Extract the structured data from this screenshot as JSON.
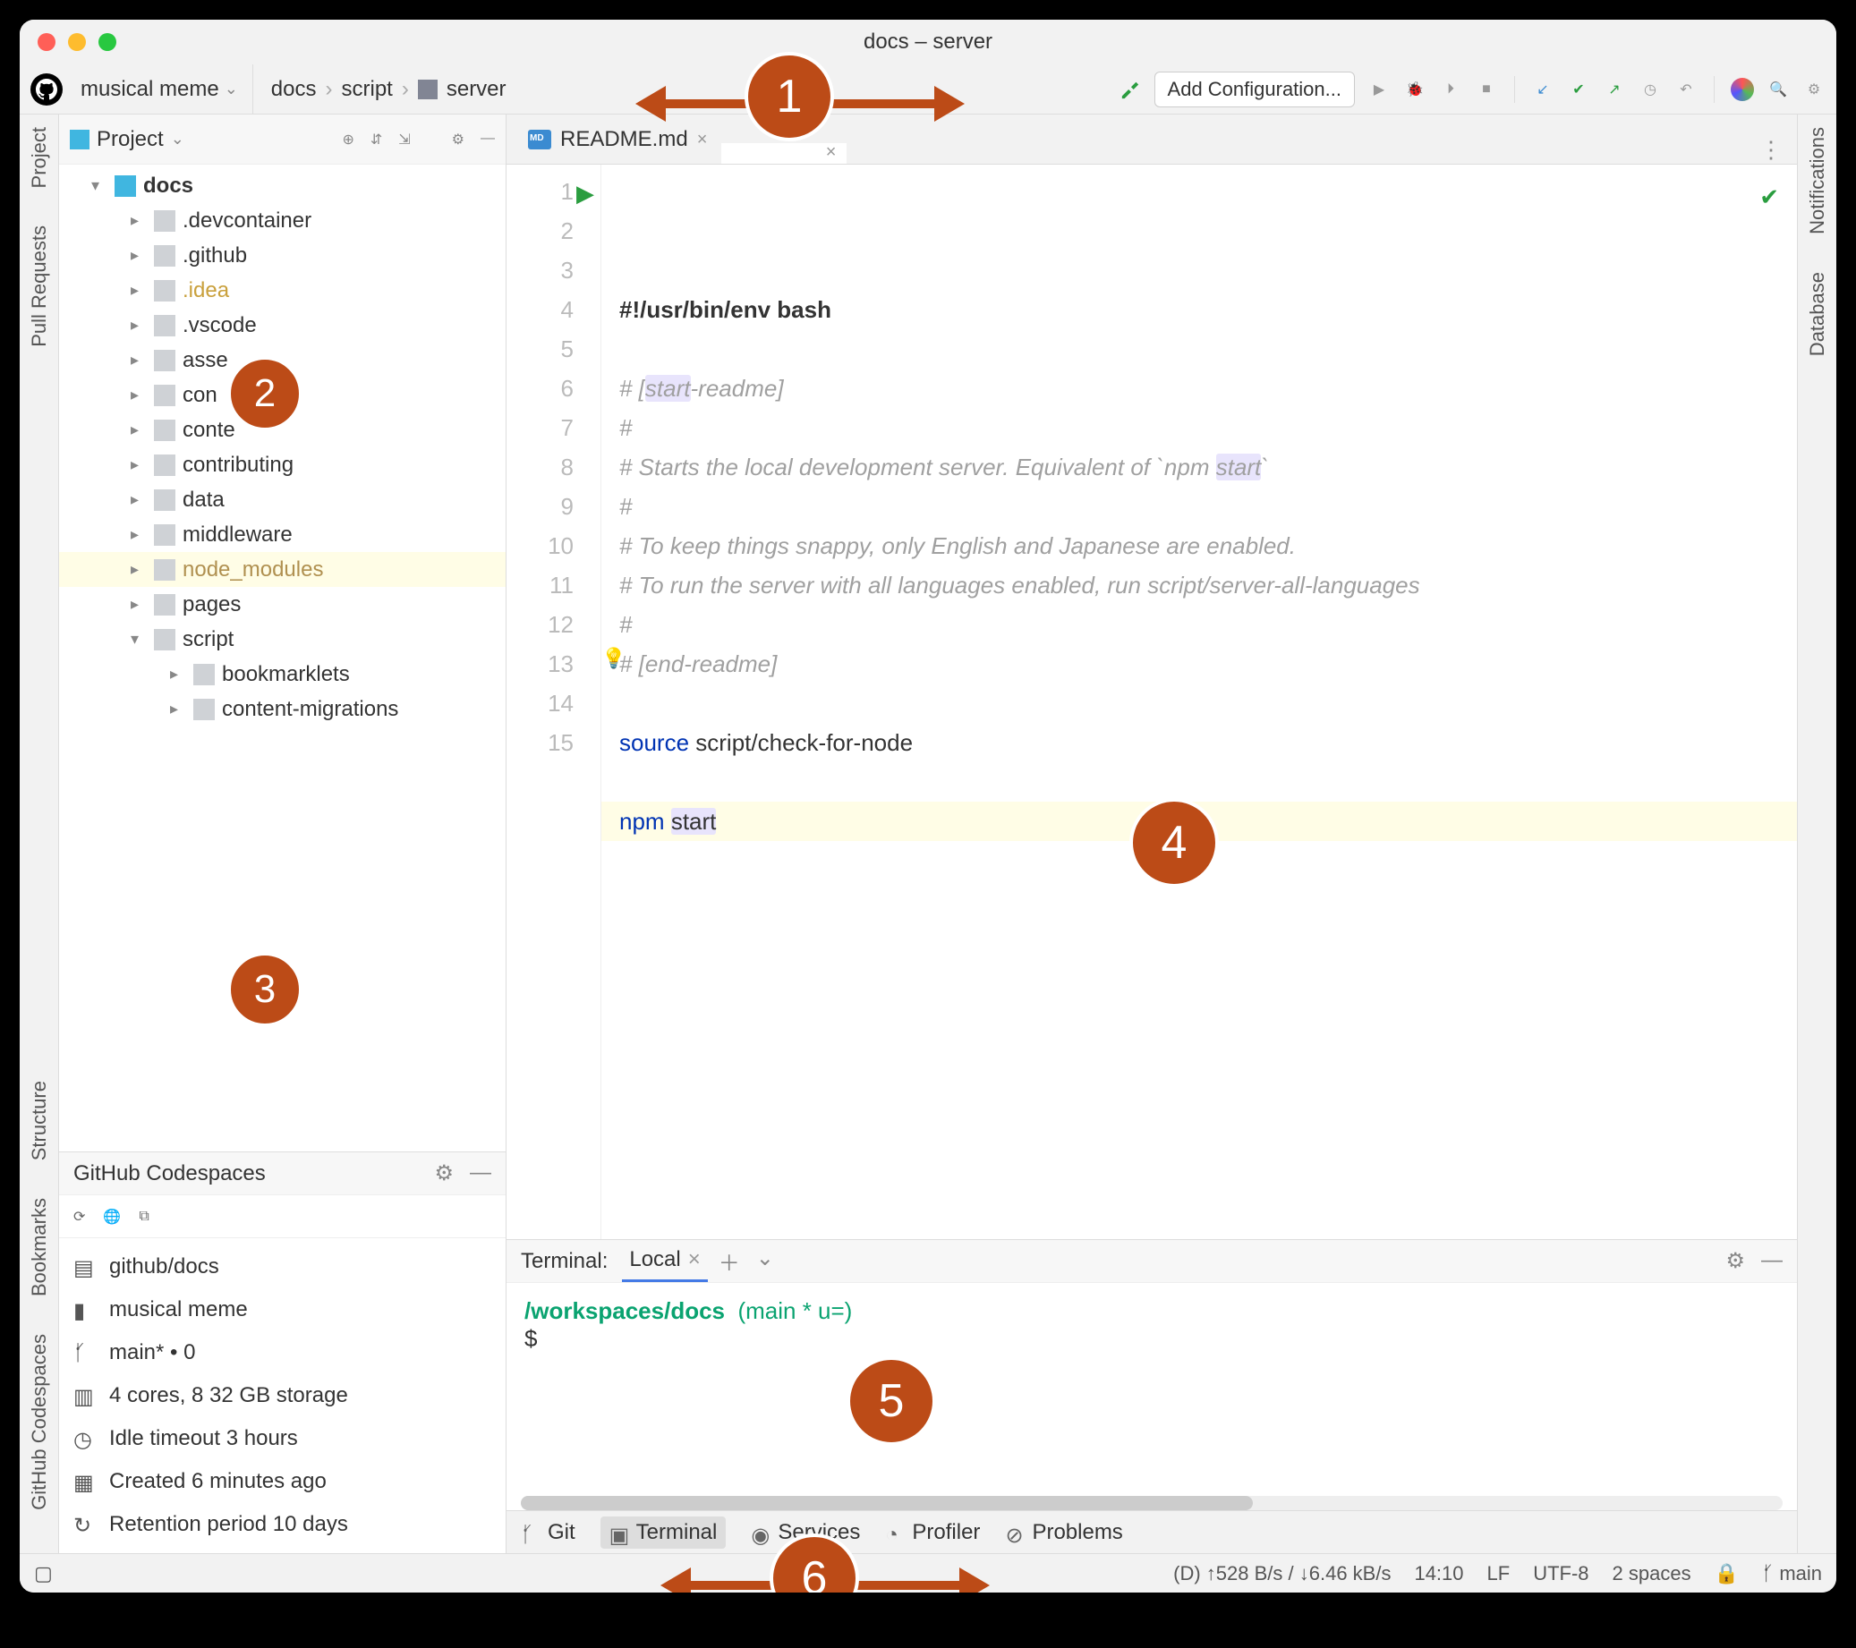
{
  "window": {
    "title": "docs – server"
  },
  "project_selector": "musical meme",
  "breadcrumb": [
    "docs",
    "script",
    "server"
  ],
  "add_config": "Add Configuration...",
  "left_rail": [
    "Project",
    "Pull Requests",
    "Structure",
    "Bookmarks",
    "GitHub Codespaces"
  ],
  "right_rail": [
    "Notifications",
    "Database"
  ],
  "project_panel": {
    "title": "Project"
  },
  "tree": [
    {
      "depth": 1,
      "arrow": "▾",
      "folder": "blue",
      "label": "docs",
      "bold": true
    },
    {
      "depth": 2,
      "arrow": "▸",
      "folder": "gray",
      "label": ".devcontainer"
    },
    {
      "depth": 2,
      "arrow": "▸",
      "folder": "gray",
      "label": ".github"
    },
    {
      "depth": 2,
      "arrow": "▸",
      "folder": "gray",
      "label": ".idea",
      "class": "hl"
    },
    {
      "depth": 2,
      "arrow": "▸",
      "folder": "gray",
      "label": ".vscode"
    },
    {
      "depth": 2,
      "arrow": "▸",
      "folder": "gray",
      "label": "asse"
    },
    {
      "depth": 2,
      "arrow": "▸",
      "folder": "gray",
      "label": "con"
    },
    {
      "depth": 2,
      "arrow": "▸",
      "folder": "gray",
      "label": "conte"
    },
    {
      "depth": 2,
      "arrow": "▸",
      "folder": "gray",
      "label": "contributing"
    },
    {
      "depth": 2,
      "arrow": "▸",
      "folder": "gray",
      "label": "data"
    },
    {
      "depth": 2,
      "arrow": "▸",
      "folder": "gray",
      "label": "middleware"
    },
    {
      "depth": 2,
      "arrow": "▸",
      "folder": "gray",
      "label": "node_modules",
      "class": "excl",
      "sel": true
    },
    {
      "depth": 2,
      "arrow": "▸",
      "folder": "gray",
      "label": "pages"
    },
    {
      "depth": 2,
      "arrow": "▾",
      "folder": "gray",
      "label": "script"
    },
    {
      "depth": 3,
      "arrow": "▸",
      "folder": "gray",
      "label": "bookmarklets"
    },
    {
      "depth": 3,
      "arrow": "▸",
      "folder": "gray",
      "label": "content-migrations",
      "class": "dim"
    }
  ],
  "codespaces": {
    "title": "GitHub Codespaces",
    "rows": [
      {
        "icon": "repo",
        "text": "github/docs"
      },
      {
        "icon": "bookmark",
        "text": "musical meme"
      },
      {
        "icon": "branch",
        "text": "main* • 0"
      },
      {
        "icon": "server",
        "text": "4 cores, 8          32 GB storage"
      },
      {
        "icon": "clock",
        "text": "Idle timeout 3 hours"
      },
      {
        "icon": "calendar",
        "text": "Created 6 minutes ago"
      },
      {
        "icon": "history",
        "text": "Retention period 10 days"
      }
    ]
  },
  "tabs": [
    {
      "label": "README.md",
      "icon": "md",
      "active": false
    },
    {
      "label": "",
      "icon": "sh",
      "active": true,
      "obscured": true
    }
  ],
  "code": {
    "lines": 15,
    "content": [
      "#!/usr/bin/env bash",
      "",
      "# [start-readme]",
      "#",
      "# Starts the local development server. Equivalent of `npm start`",
      "#",
      "# To keep things snappy, only English and Japanese are enabled.",
      "# To run the server with all languages enabled, run script/server-all-languages",
      "#",
      "# [end-readme]",
      "",
      "source script/check-for-node",
      "",
      "npm start",
      ""
    ]
  },
  "terminal": {
    "title": "Terminal:",
    "tab": "Local",
    "path": "/workspaces/docs",
    "branch": "(main * u=)",
    "prompt": "$"
  },
  "bottom_tools": [
    "Git",
    "Terminal",
    "Services",
    "Profiler",
    "Problems"
  ],
  "status": {
    "net": "(D) ↑528 B/s / ↓6.46 kB/s",
    "pos": "14:10",
    "le": "LF",
    "enc": "UTF-8",
    "indent": "2 spaces",
    "branch": "main"
  },
  "callouts": [
    "1",
    "2",
    "3",
    "4",
    "5",
    "6"
  ]
}
